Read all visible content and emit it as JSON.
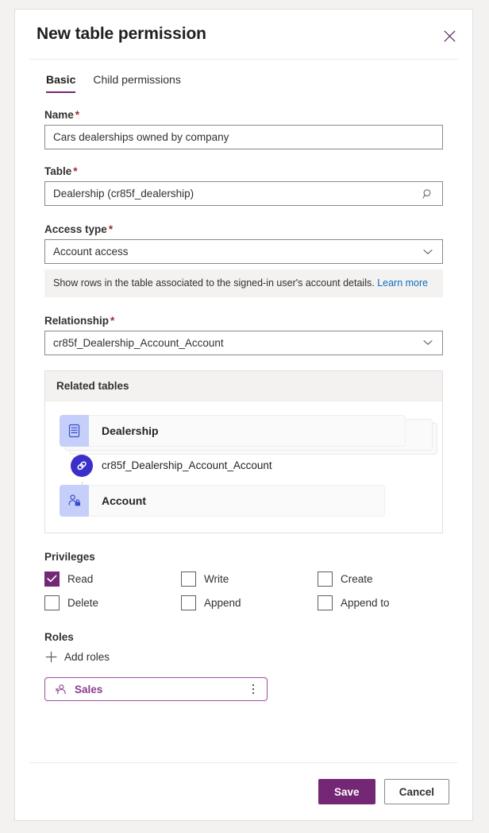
{
  "dialog": {
    "title": "New table permission",
    "close_icon": "close-icon"
  },
  "tabs": [
    {
      "label": "Basic",
      "active": true
    },
    {
      "label": "Child permissions",
      "active": false
    }
  ],
  "form": {
    "name": {
      "label": "Name",
      "required": "*",
      "value": "Cars dealerships owned by company"
    },
    "table": {
      "label": "Table",
      "required": "*",
      "value": "Dealership (cr85f_dealership)",
      "icon": "search-icon"
    },
    "access_type": {
      "label": "Access type",
      "required": "*",
      "value": "Account access",
      "icon": "chevron-down-icon",
      "hint_text": "Show rows in the table associated to the signed-in user's account details.",
      "hint_link": "Learn more"
    },
    "relationship": {
      "label": "Relationship",
      "required": "*",
      "value": "cr85f_Dealership_Account_Account",
      "icon": "chevron-down-icon"
    }
  },
  "related_tables": {
    "header": "Related tables",
    "source_table": "Dealership",
    "relationship": "cr85f_Dealership_Account_Account",
    "target_table": "Account",
    "icons": {
      "source": "table-icon",
      "relationship": "link-icon",
      "target": "account-person-icon"
    }
  },
  "privileges": {
    "title": "Privileges",
    "items": [
      {
        "label": "Read",
        "checked": true
      },
      {
        "label": "Write",
        "checked": false
      },
      {
        "label": "Create",
        "checked": false
      },
      {
        "label": "Delete",
        "checked": false
      },
      {
        "label": "Append",
        "checked": false
      },
      {
        "label": "Append to",
        "checked": false
      }
    ]
  },
  "roles": {
    "title": "Roles",
    "add_label": "Add roles",
    "add_icon": "plus-icon",
    "chips": [
      {
        "label": "Sales",
        "icon": "person-icon",
        "more_icon": "more-vertical-icon"
      }
    ]
  },
  "footer": {
    "save_label": "Save",
    "cancel_label": "Cancel"
  },
  "colors": {
    "accent": "#742774",
    "link": "#0f6cbd",
    "required": "#a4262c",
    "node_icon_bg": "#c5cffa",
    "relationship_badge": "#3b2fc9"
  }
}
